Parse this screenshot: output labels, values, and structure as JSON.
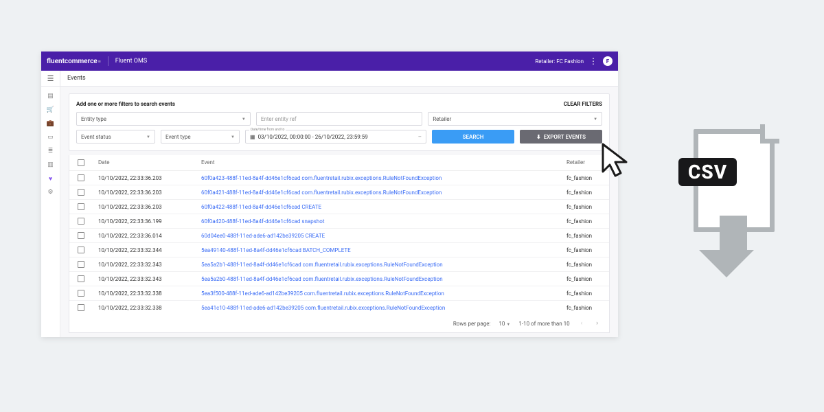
{
  "topbar": {
    "brand": "fluentcommerce",
    "app_name": "Fluent OMS",
    "retailer_label": "Retailer: FC Fashion",
    "avatar_letter": "F"
  },
  "page": {
    "title": "Events"
  },
  "filters": {
    "title": "Add one or more filters to search events",
    "clear": "CLEAR FILTERS",
    "entity_type": "Entity type",
    "entity_ref_placeholder": "Enter entity ref",
    "retailer": "Retailer",
    "event_status": "Event status",
    "event_type": "Event type",
    "date_label": "Date/time from and to",
    "date_value": "03/10/2022, 00:00:00 - 26/10/2022, 23:59:59",
    "search": "SEARCH",
    "export": "EXPORT EVENTS"
  },
  "table": {
    "headers": {
      "date": "Date",
      "event": "Event",
      "retailer": "Retailer"
    },
    "rows": [
      {
        "date": "10/10/2022, 22:33:36.203",
        "event": "60f0a423-488f-11ed-8a4f-dd46e1cf6cad com.fluentretail.rubix.exceptions.RuleNotFoundException",
        "retailer": "fc_fashion"
      },
      {
        "date": "10/10/2022, 22:33:36.203",
        "event": "60f0a421-488f-11ed-8a4f-dd46e1cf6cad com.fluentretail.rubix.exceptions.RuleNotFoundException",
        "retailer": "fc_fashion"
      },
      {
        "date": "10/10/2022, 22:33:36.203",
        "event": "60f0a422-488f-11ed-8a4f-dd46e1cf6cad CREATE",
        "retailer": "fc_fashion"
      },
      {
        "date": "10/10/2022, 22:33:36.199",
        "event": "60f0a420-488f-11ed-8a4f-dd46e1cf6cad snapshot",
        "retailer": "fc_fashion"
      },
      {
        "date": "10/10/2022, 22:33:36.014",
        "event": "60d04ee0-488f-11ed-ade6-ad142be39205 CREATE",
        "retailer": "fc_fashion"
      },
      {
        "date": "10/10/2022, 22:33:32.344",
        "event": "5ea49140-488f-11ed-8a4f-dd46e1cf6cad BATCH_COMPLETE",
        "retailer": "fc_fashion"
      },
      {
        "date": "10/10/2022, 22:33:32.343",
        "event": "5ea5a2b1-488f-11ed-8a4f-dd46e1cf6cad com.fluentretail.rubix.exceptions.RuleNotFoundException",
        "retailer": "fc_fashion"
      },
      {
        "date": "10/10/2022, 22:33:32.343",
        "event": "5ea5a2b0-488f-11ed-8a4f-dd46e1cf6cad com.fluentretail.rubix.exceptions.RuleNotFoundException",
        "retailer": "fc_fashion"
      },
      {
        "date": "10/10/2022, 22:33:32.338",
        "event": "5ea3f500-488f-11ed-ade6-ad142be39205 com.fluentretail.rubix.exceptions.RuleNotFoundException",
        "retailer": "fc_fashion"
      },
      {
        "date": "10/10/2022, 22:33:32.338",
        "event": "5ea41c10-488f-11ed-ade6-ad142be39205 com.fluentretail.rubix.exceptions.RuleNotFoundException",
        "retailer": "fc_fashion"
      }
    ]
  },
  "footer": {
    "rows_per_page_label": "Rows per page:",
    "rows_per_page_value": "10",
    "range": "1-10 of more than 10"
  },
  "illus": {
    "csv_label": "CSV"
  }
}
